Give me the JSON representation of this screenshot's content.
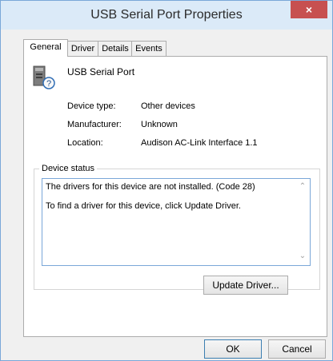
{
  "window": {
    "title": "USB Serial Port Properties",
    "close_glyph": "×"
  },
  "tabs": [
    {
      "label": "General",
      "active": true
    },
    {
      "label": "Driver",
      "active": false
    },
    {
      "label": "Details",
      "active": false
    },
    {
      "label": "Events",
      "active": false
    }
  ],
  "device": {
    "name": "USB Serial Port",
    "icon": "unknown-device-icon",
    "properties": [
      {
        "label": "Device type:",
        "value": "Other devices"
      },
      {
        "label": "Manufacturer:",
        "value": "Unknown"
      },
      {
        "label": "Location:",
        "value": "Audison AC-Link Interface 1.1"
      }
    ]
  },
  "device_status": {
    "group_label": "Device status",
    "lines": [
      "The drivers for this device are not installed. (Code 28)",
      "To find a driver for this device, click Update Driver."
    ]
  },
  "buttons": {
    "update_driver": "Update Driver...",
    "ok": "OK",
    "cancel": "Cancel"
  }
}
